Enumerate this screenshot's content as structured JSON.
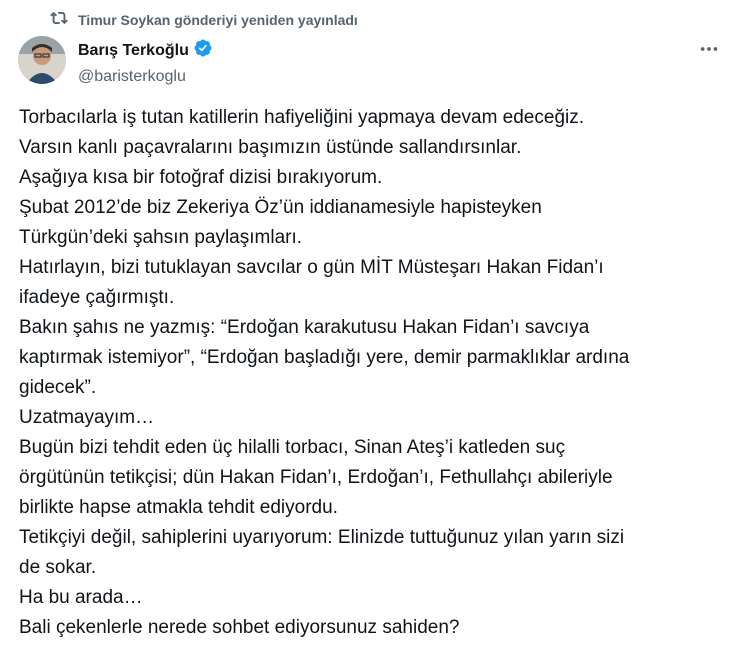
{
  "repost": {
    "icon": "repost-icon",
    "text": "Timur Soykan gönderiyi yeniden yayınladı"
  },
  "author": {
    "name": "Barış Terkoğlu",
    "handle": "@baristerkoglu",
    "verified": true,
    "verified_color": "#1d9bf0",
    "avatar": "avatar"
  },
  "more_icon": "more-icon",
  "lines": [
    "Torbacılarla iş tutan katillerin hafiyeliğini yapmaya devam edeceğiz.",
    "Varsın kanlı paçavralarını başımızın üstünde sallandırsınlar.",
    "Aşağıya kısa bir fotoğraf dizisi bırakıyorum.",
    "Şubat 2012’de biz Zekeriya Öz’ün iddianamesiyle hapisteyken",
    "Türkgün’deki şahsın paylaşımları.",
    "Hatırlayın, bizi tutuklayan savcılar o gün MİT Müsteşarı Hakan Fidan’ı",
    "ifadeye çağırmıştı.",
    "Bakın şahıs ne yazmış: “Erdoğan karakutusu Hakan Fidan’ı savcıya",
    "kaptırmak istemiyor”, “Erdoğan başladığı yere, demir parmaklıklar ardına",
    "gidecek”.",
    "Uzatmayayım…",
    "Bugün bizi tehdit eden üç hilalli torbacı, Sinan Ateş’i katleden suç",
    "örgütünün tetikçisi; dün Hakan Fidan’ı, Erdoğan’ı, Fethullahçı abileriyle",
    "birlikte hapse atmakla tehdit ediyordu.",
    "Tetikçiyi değil, sahiplerini uyarıyorum: Elinizde tuttuğunuz yılan yarın sizi",
    "de sokar.",
    "Ha bu arada…",
    "Bali çekenlerle nerede sohbet ediyorsunuz sahiden?"
  ]
}
